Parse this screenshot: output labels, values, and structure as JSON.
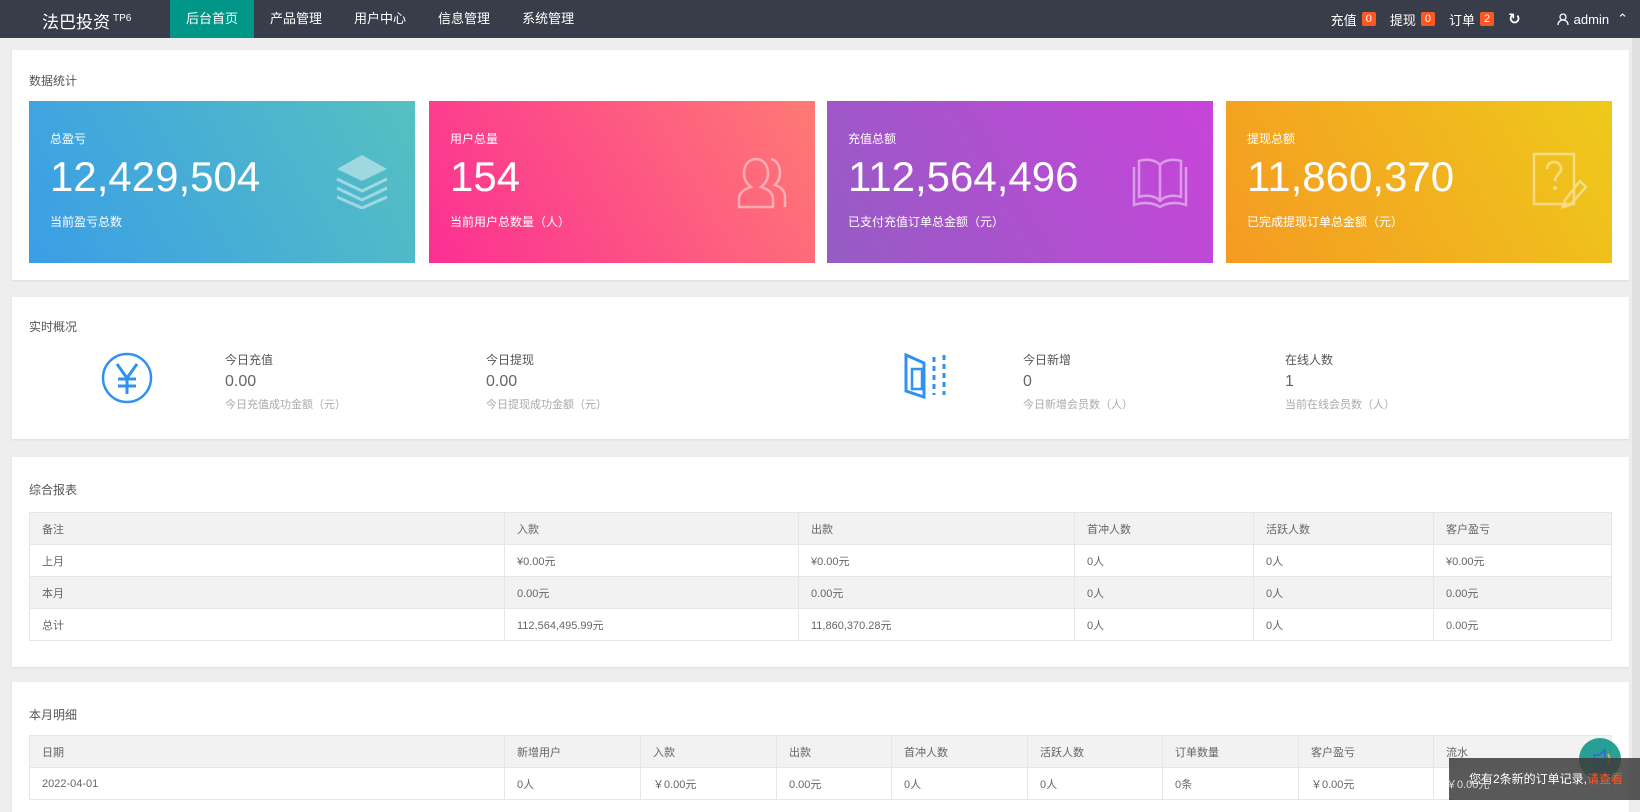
{
  "header": {
    "brand": "法巴投资",
    "brand_sup": "TP6",
    "nav": [
      {
        "label": "后台首页",
        "active": true
      },
      {
        "label": "产品管理"
      },
      {
        "label": "用户中心"
      },
      {
        "label": "信息管理"
      },
      {
        "label": "系统管理"
      }
    ],
    "recharge_label": "充值",
    "recharge_count": "0",
    "withdraw_label": "提现",
    "withdraw_count": "0",
    "order_label": "订单",
    "order_count": "2",
    "user": "admin"
  },
  "stats": {
    "title": "数据统计",
    "cards": [
      {
        "label": "总盈亏",
        "value": "12,429,504",
        "desc": "当前盈亏总数",
        "icon": "layers-icon"
      },
      {
        "label": "用户总量",
        "value": "154",
        "desc": "当前用户总数量（人）",
        "icon": "users-icon"
      },
      {
        "label": "充值总额",
        "value": "112,564,496",
        "desc": "已支付充值订单总金额（元）",
        "icon": "book-icon"
      },
      {
        "label": "提现总额",
        "value": "11,860,370",
        "desc": "已完成提现订单总金额（元）",
        "icon": "question-note-icon"
      }
    ]
  },
  "realtime": {
    "title": "实时概况",
    "items": [
      {
        "label": "今日充值",
        "value": "0.00",
        "desc": "今日充值成功金额（元）"
      },
      {
        "label": "今日提现",
        "value": "0.00",
        "desc": "今日提现成功金额（元）"
      },
      {
        "label": "今日新增",
        "value": "0",
        "desc": "今日新增会员数（人）"
      },
      {
        "label": "在线人数",
        "value": "1",
        "desc": "当前在线会员数（人）"
      }
    ]
  },
  "report": {
    "title": "综合报表",
    "headers": [
      "备注",
      "入款",
      "出款",
      "首冲人数",
      "活跃人数",
      "客户盈亏"
    ],
    "rows": [
      [
        "上月",
        "¥0.00元",
        "¥0.00元",
        "0人",
        "0人",
        "¥0.00元"
      ],
      [
        "本月",
        "0.00元",
        "0.00元",
        "0人",
        "0人",
        "0.00元"
      ],
      [
        "总计",
        "112,564,495.99元",
        "11,860,370.28元",
        "0人",
        "0人",
        "0.00元"
      ]
    ]
  },
  "monthly": {
    "title": "本月明细",
    "headers": [
      "日期",
      "新增用户",
      "入款",
      "出款",
      "首冲人数",
      "活跃人数",
      "订单数量",
      "客户盈亏",
      "流水"
    ],
    "rows": [
      [
        "2022-04-01",
        "0人",
        "￥0.00元",
        "0.00元",
        "0人",
        "0人",
        "0条",
        "￥0.00元",
        "￥0.00元"
      ]
    ]
  },
  "toast": {
    "text": "您有2条新的订单记录,",
    "link": "请查看"
  }
}
